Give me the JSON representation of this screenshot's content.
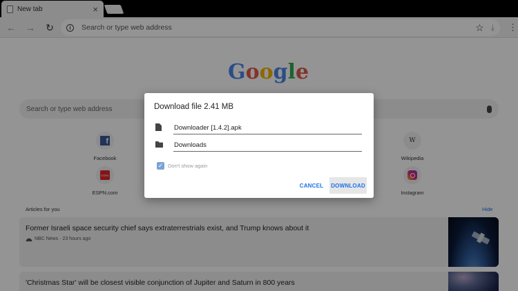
{
  "tab": {
    "title": "New tab",
    "close": "×"
  },
  "omnibox": {
    "placeholder": "Search or type web address"
  },
  "ntp": {
    "logo": [
      "G",
      "o",
      "o",
      "g",
      "l",
      "e"
    ],
    "search_placeholder": "Search or type web address",
    "tiles": [
      {
        "label": "Facebook",
        "icon": "facebook-icon",
        "glyph": "f"
      },
      {
        "label": "Wikipedia",
        "icon": "wikipedia-icon",
        "glyph": "W"
      },
      {
        "label": "ESPN.com",
        "icon": "espn-icon",
        "glyph": "ESPN"
      },
      {
        "label": "Instagram",
        "icon": "instagram-icon",
        "glyph": ""
      }
    ],
    "articles_header": "Articles for you",
    "hide_label": "Hide",
    "articles": [
      {
        "headline": "Former Israeli space security chief says extraterrestrials exist, and Trump knows about it",
        "source": "NBC News · 23 hours ago"
      },
      {
        "headline": "'Christmas Star' will be closest visible conjunction of Jupiter and Saturn in 800 years",
        "source": ""
      }
    ]
  },
  "dialog": {
    "title": "Download file 2.41 MB",
    "filename": "Downloader [1.4.2].apk",
    "location": "Downloads",
    "checkbox_label": "Don't show again",
    "checkbox_checked": true,
    "cancel_label": "CANCEL",
    "download_label": "DOWNLOAD"
  },
  "colors": {
    "accent": "#1a73e8",
    "overlay": "rgba(0,0,0,0.42)"
  }
}
